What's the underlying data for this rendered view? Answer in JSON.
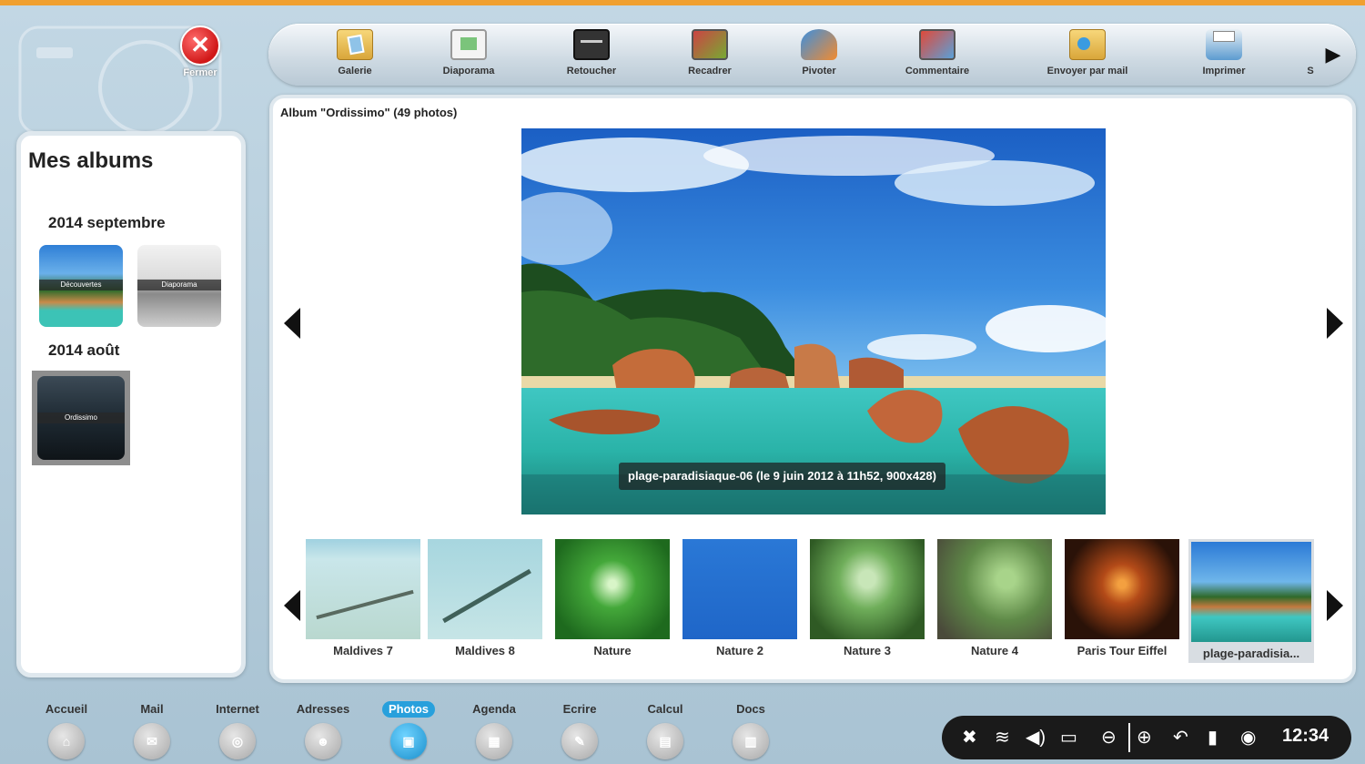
{
  "window": {
    "close_label": "Fermer"
  },
  "toolbar": {
    "tools": [
      {
        "label": "Galerie",
        "icon": "gallery-icon"
      },
      {
        "label": "Diaporama",
        "icon": "slideshow-icon"
      },
      {
        "label": "Retoucher",
        "icon": "retouch-icon"
      },
      {
        "label": "Recadrer",
        "icon": "crop-icon"
      },
      {
        "label": "Pivoter",
        "icon": "rotate-icon"
      },
      {
        "label": "Commentaire",
        "icon": "comment-icon"
      },
      {
        "label": "Envoyer par mail",
        "icon": "send-mail-icon"
      },
      {
        "label": "Imprimer",
        "icon": "print-icon"
      }
    ],
    "more_label": "S"
  },
  "sidebar": {
    "title": "Mes albums",
    "groups": [
      {
        "year": "2014 septembre",
        "albums": [
          {
            "caption": "Découvertes"
          },
          {
            "caption": "Diaporama"
          }
        ]
      },
      {
        "year": "2014 août",
        "albums": [
          {
            "caption": "Ordissimo"
          }
        ]
      }
    ]
  },
  "main": {
    "album_title": "Album \"Ordissimo\" (49 photos)",
    "photo_caption": "plage-paradisiaque-06 (le  9 juin 2012 à 11h52, 900x428)",
    "thumbnails": [
      {
        "label": "Maldives 7"
      },
      {
        "label": "Maldives 8"
      },
      {
        "label": "Nature"
      },
      {
        "label": "Nature 2"
      },
      {
        "label": "Nature 3"
      },
      {
        "label": "Nature 4"
      },
      {
        "label": "Paris Tour Eiffel"
      },
      {
        "label": "plage-paradisia..."
      }
    ]
  },
  "dock": {
    "apps": [
      {
        "label": "Accueil"
      },
      {
        "label": "Mail"
      },
      {
        "label": "Internet"
      },
      {
        "label": "Adresses"
      },
      {
        "label": "Photos",
        "active": true
      },
      {
        "label": "Agenda"
      },
      {
        "label": "Ecrire"
      },
      {
        "label": "Calcul"
      },
      {
        "label": "Docs"
      }
    ]
  },
  "systray": {
    "time": "12:34",
    "icons": [
      "tools-icon",
      "wifi-icon",
      "volume-icon",
      "battery-icon",
      "zoom-out-icon",
      "zoom-in-icon",
      "undo-icon",
      "trash-icon",
      "help-icon"
    ]
  },
  "colors": {
    "accent": "#f0a030",
    "active_app": "#28a0dc",
    "close_button": "#d01818"
  }
}
